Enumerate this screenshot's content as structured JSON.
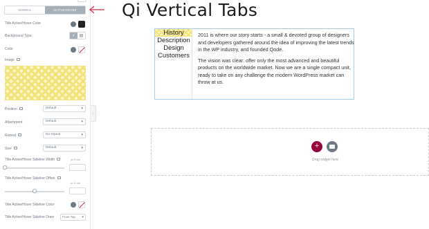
{
  "panel": {
    "state_tabs": {
      "normal": "NORMAL",
      "active_hover": "ACTIVE/HOVER",
      "selected": "ACTIVE/HOVER"
    },
    "controls": {
      "title_color": "Title Active/Hover Color",
      "background_type": "Background Type",
      "color": "Color",
      "image": "Image",
      "position": {
        "label": "Position",
        "value": "Default"
      },
      "attachment": {
        "label": "Attachment",
        "value": "Default"
      },
      "repeat": {
        "label": "Repeat",
        "value": "No-repeat"
      },
      "size": {
        "label": "Size",
        "value": "Default"
      },
      "sideline_width": {
        "label": "Title Active/Hover Sideline Width",
        "units": "px % em"
      },
      "sideline_offset": {
        "label": "Title Active/Hover Sideline Offset",
        "units": "px % em"
      },
      "sideline_color": "Title Active/Hover Sideline Color",
      "sideline_draw": {
        "label": "Title Active/Hover Sideline Draw",
        "value": "From Top"
      }
    }
  },
  "heading": "Qi Vertical Tabs",
  "widget": {
    "tabs": [
      "History",
      "Description",
      "Design",
      "Customers"
    ],
    "active_tab": "History",
    "content": [
      "2011 is where our story starts - a small & devoted group of designers and developers gathered around the idea of improving the latest trends in the WP industry, and founded Qode.",
      "The vision was clear: offer only the most advanced and beautiful products on the worldwide market. Now we are a single compact unit, ready to take on any challenge the modern WordPress market can throw at us."
    ]
  },
  "drop_zone": {
    "add_symbol": "+",
    "hint": "Drag widget here"
  },
  "colors": {
    "accent": "#93003a",
    "arrow": "#d72b3f",
    "highlight": "#fbf5c7",
    "stripe": "#f2e27a",
    "widget_border": "#a8cde8"
  }
}
